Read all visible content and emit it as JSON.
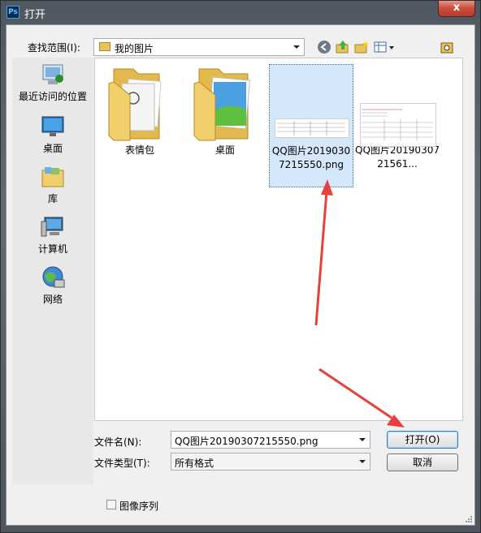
{
  "window": {
    "title": "打开",
    "app_icon": "Ps",
    "close_label": "x"
  },
  "toolbar": {
    "lookin_label": "查找范围(I):",
    "location": "我的图片"
  },
  "places": [
    {
      "label": "最近访问的位置",
      "icon": "recent-places-icon"
    },
    {
      "label": "桌面",
      "icon": "desktop-icon"
    },
    {
      "label": "库",
      "icon": "libraries-icon"
    },
    {
      "label": "计算机",
      "icon": "computer-icon"
    },
    {
      "label": "网络",
      "icon": "network-icon"
    }
  ],
  "files": [
    {
      "name": "表情包",
      "type": "folder"
    },
    {
      "name": "桌面",
      "type": "folder"
    },
    {
      "name": "QQ图片20190307215550.png",
      "type": "image",
      "selected": true
    },
    {
      "name": "QQ图片2019030721561...",
      "type": "image"
    }
  ],
  "form": {
    "filename_label": "文件名(N):",
    "filename_value": "QQ图片20190307215550.png",
    "filetype_label": "文件类型(T):",
    "filetype_value": "所有格式",
    "open_button": "打开(O)",
    "cancel_button": "取消",
    "image_sequence_label": "图像序列"
  }
}
